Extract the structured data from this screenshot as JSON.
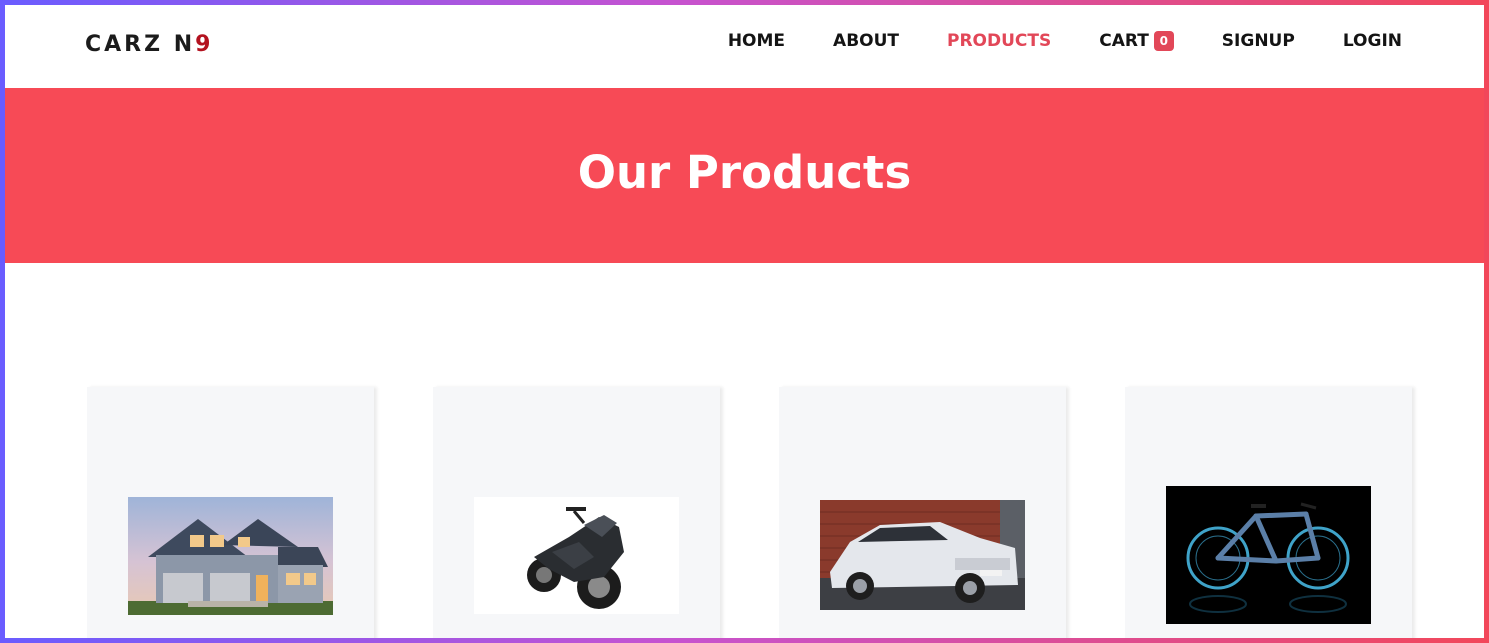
{
  "brand": {
    "logo_text": "CARZ N",
    "logo_accent": "9",
    "accent_color": "#b3121f"
  },
  "nav": {
    "home": "HOME",
    "about": "ABOUT",
    "products": "PRODUCTS",
    "cart": "CART",
    "cart_count": "0",
    "signup": "SIGNUP",
    "login": "LOGIN",
    "active_color": "#e24758"
  },
  "hero": {
    "title": "Our Products",
    "background": "#f74a56"
  },
  "products": [
    {
      "image": "house"
    },
    {
      "image": "motorcycle"
    },
    {
      "image": "suv"
    },
    {
      "image": "bicycle"
    }
  ]
}
